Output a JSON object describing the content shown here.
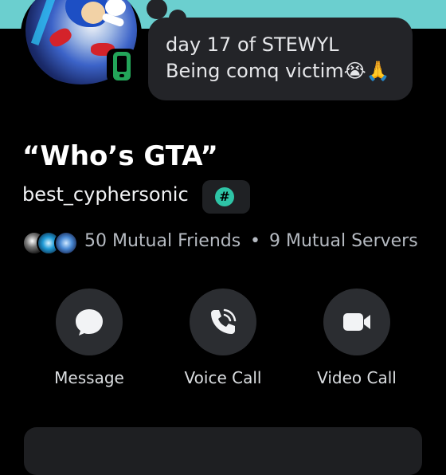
{
  "profile": {
    "status_text": "day 17 of STEWYL Being comq victim😭🙏",
    "display_name": "“Who’s GTA”",
    "username": "best_cyphersonic",
    "tag_icon": "hash-icon",
    "tag_symbol": "#",
    "presence": "mobile-online",
    "mutual_friends": "50 Mutual Friends",
    "separator": "•",
    "mutual_servers": "9 Mutual Servers"
  },
  "actions": [
    {
      "label": "Message",
      "icon": "chat-bubble-icon"
    },
    {
      "label": "Voice Call",
      "icon": "phone-icon"
    },
    {
      "label": "Video Call",
      "icon": "video-camera-icon"
    }
  ],
  "colors": {
    "banner": "#6bcfcf",
    "presence_online": "#23a559",
    "tag_badge_icon": "#2ec4a6",
    "background": "#000000",
    "button_bg": "#2b2d31"
  }
}
